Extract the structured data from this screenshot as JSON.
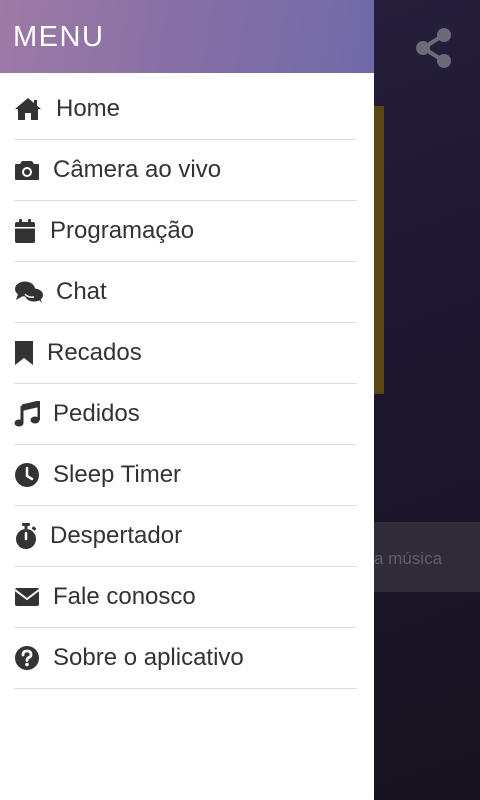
{
  "background": {
    "partial_text": "a música",
    "share_icon": "share-icon"
  },
  "drawer": {
    "title": "MENU",
    "items": [
      {
        "label": "Home",
        "icon": "home-icon"
      },
      {
        "label": "Câmera ao vivo",
        "icon": "camera-icon"
      },
      {
        "label": "Programação",
        "icon": "calendar-icon"
      },
      {
        "label": "Chat",
        "icon": "chat-icon"
      },
      {
        "label": "Recados",
        "icon": "bookmark-icon"
      },
      {
        "label": "Pedidos",
        "icon": "music-icon"
      },
      {
        "label": "Sleep Timer",
        "icon": "clock-icon"
      },
      {
        "label": "Despertador",
        "icon": "stopwatch-icon"
      },
      {
        "label": "Fale conosco",
        "icon": "envelope-icon"
      },
      {
        "label": "Sobre o aplicativo",
        "icon": "question-circle-icon"
      }
    ]
  },
  "colors": {
    "header_start": "#9e7aa6",
    "header_end": "#6f6aa8",
    "text": "#333333",
    "divider": "#dcdcdc"
  }
}
